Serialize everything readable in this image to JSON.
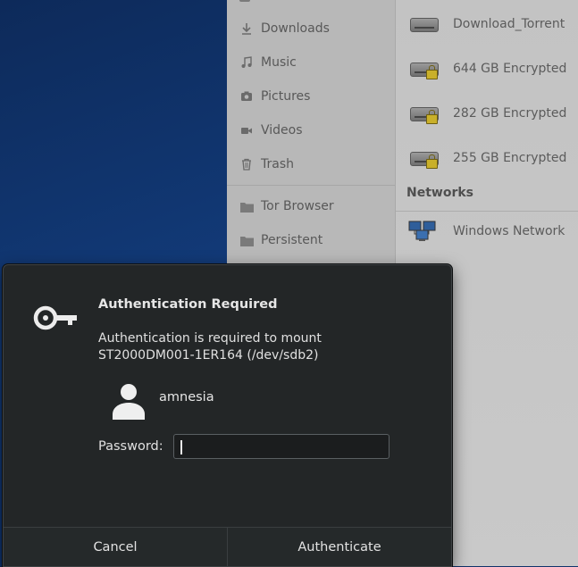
{
  "sidebar": {
    "items": [
      {
        "label": "Downloads",
        "icon": "download-icon"
      },
      {
        "label": "Music",
        "icon": "music-note-icon"
      },
      {
        "label": "Pictures",
        "icon": "camera-icon"
      },
      {
        "label": "Videos",
        "icon": "video-icon"
      },
      {
        "label": "Trash",
        "icon": "trash-icon"
      }
    ],
    "bookmarks": [
      {
        "label": "Tor Browser",
        "icon": "folder-icon"
      },
      {
        "label": "Persistent",
        "icon": "folder-icon"
      }
    ]
  },
  "devices": {
    "items": [
      {
        "label": "Download_Torrent",
        "icon": "drive-icon",
        "locked": false
      },
      {
        "label": "644 GB Encrypted",
        "icon": "encrypted-drive-icon",
        "locked": true
      },
      {
        "label": "282 GB Encrypted",
        "icon": "encrypted-drive-icon",
        "locked": true
      },
      {
        "label": "255 GB Encrypted",
        "icon": "encrypted-drive-icon",
        "locked": true
      }
    ]
  },
  "networks": {
    "heading": "Networks",
    "items": [
      {
        "label": "Windows Network",
        "icon": "network-computers-icon"
      }
    ]
  },
  "dialog": {
    "title": "Authentication Required",
    "message_line1": "Authentication is required to mount",
    "message_line2": "ST2000DM001-1ER164 (/dev/sdb2)",
    "user": "amnesia",
    "password_label": "Password:",
    "password_value": "",
    "cancel_label": "Cancel",
    "authenticate_label": "Authenticate",
    "icon": "key-icon",
    "avatar_icon": "user-avatar-icon"
  },
  "colors": {
    "dialog_bg": "#232627",
    "desktop_bg": "#123a78",
    "lock": "#c9b02a"
  }
}
